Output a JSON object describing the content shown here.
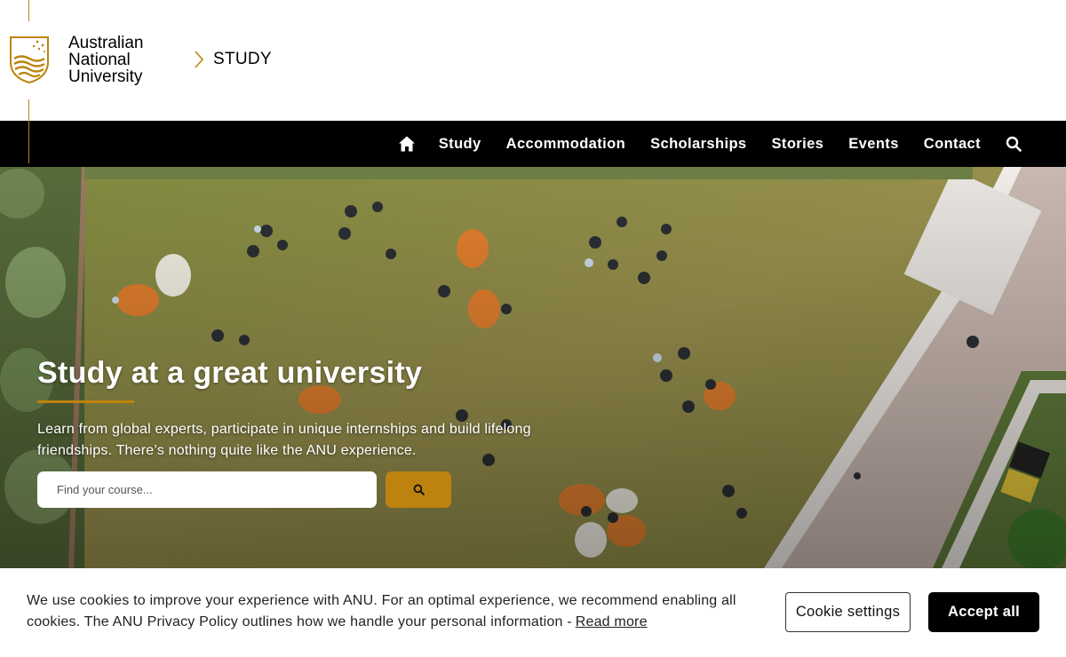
{
  "header": {
    "logo_lines": [
      "Australian",
      "National",
      "University"
    ],
    "breadcrumb": "STUDY"
  },
  "nav": {
    "home_icon": "home-icon",
    "items": [
      "Study",
      "Accommodation",
      "Scholarships",
      "Stories",
      "Events",
      "Contact"
    ],
    "search_icon": "search-icon"
  },
  "hero": {
    "title": "Study at a great university",
    "text": "Learn from global experts, participate in unique internships and build lifelong friendships. There’s nothing quite like the ANU experience.",
    "search_placeholder": "Find your course...",
    "search_button_icon": "search-icon"
  },
  "cookie": {
    "text": "We use cookies to improve your experience with ANU. For an optimal experience, we recommend enabling all cookies. The ANU Privacy Policy outlines how we handle your personal information -",
    "read_more": "Read more",
    "settings_label": "Cookie settings",
    "accept_label": "Accept all"
  },
  "colors": {
    "brand_gold": "#be830e",
    "nav_bg": "#000000",
    "grass": "#8b8b45"
  }
}
